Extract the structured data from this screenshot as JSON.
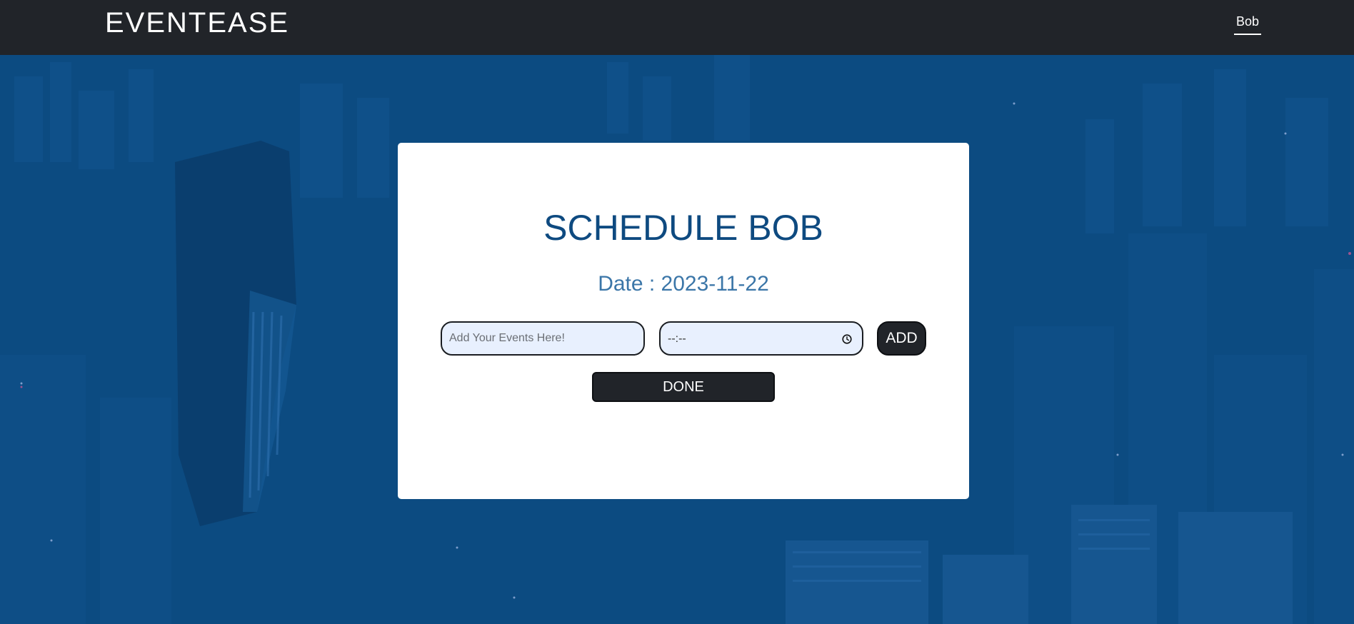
{
  "navbar": {
    "brand": "EVENTEASE",
    "user": "Bob"
  },
  "schedule": {
    "title": "SCHEDULE BOB",
    "date_text": "Date : 2023-11-22",
    "event_input": {
      "placeholder": "Add Your Events Here!",
      "value": ""
    },
    "time_input": {
      "value": "--:--"
    },
    "add_label": "ADD",
    "done_label": "DONE"
  },
  "colors": {
    "navbar_bg": "#212429",
    "hero_bg": "#0c4a80",
    "title": "#0e4a80",
    "date": "#3b76a8",
    "input_bg": "#e8f0fe",
    "button_bg": "#212429"
  },
  "icons": {
    "time_picker": "clock-icon",
    "background": "city-skyline-photo"
  }
}
